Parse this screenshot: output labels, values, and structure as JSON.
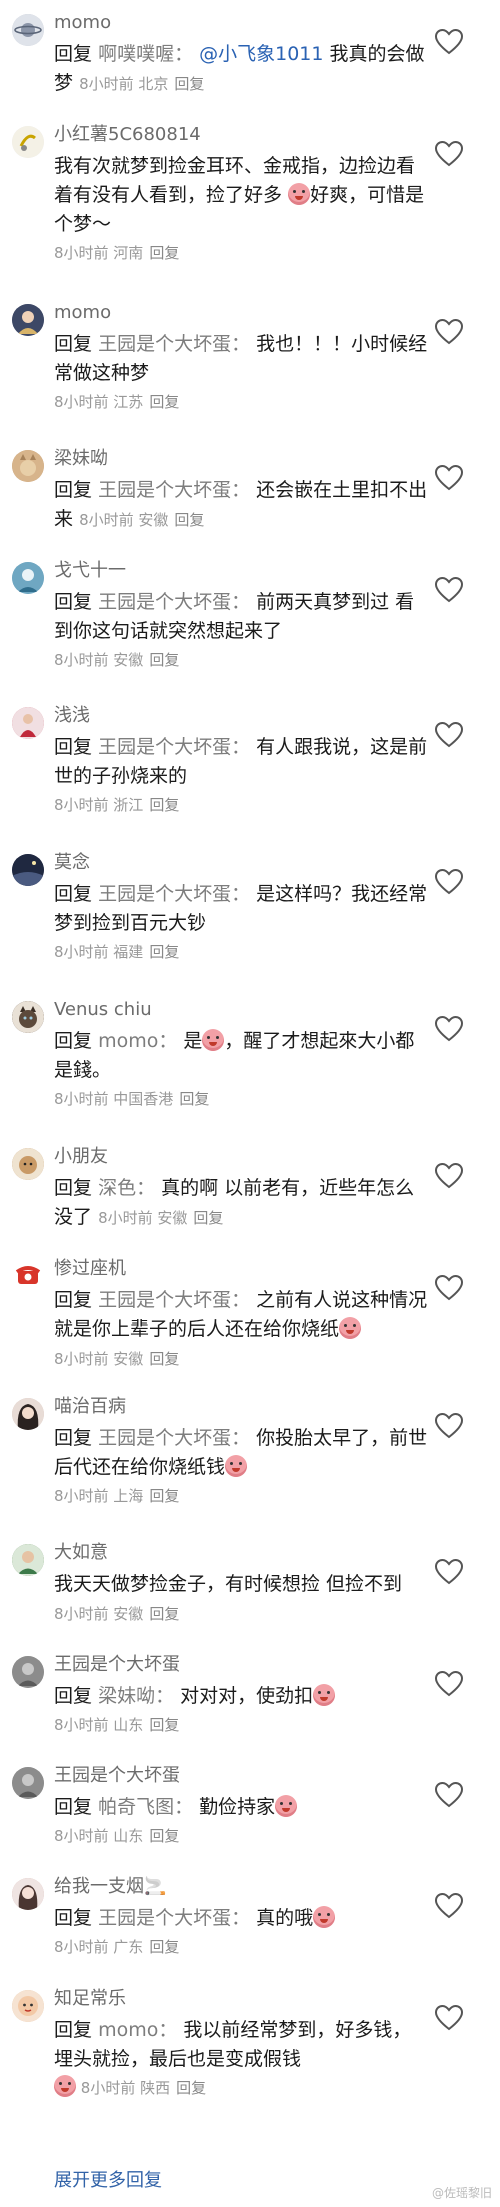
{
  "comments": [
    {
      "username": "momo",
      "avatar_color": "#c7ccd6",
      "avatar_icon": "planet-avatar-icon",
      "reply_word": "回复",
      "target": "啊噗噗喔：",
      "mention": "@小飞象1011",
      "text": "我真的会做梦",
      "meta": "8小时前 北京",
      "reply_action": "回复"
    },
    {
      "username": "小红薯5C680814",
      "avatar_color": "#eaeaea",
      "avatar_icon": "sticker-avatar-icon",
      "reply_word": "",
      "target": "",
      "mention": "",
      "text": "我有次就梦到捡金耳环、金戒指，边捡边看着有没有人看到，捡了好多",
      "text2": "好爽，可惜是个梦～",
      "meta": "8小时前 河南",
      "reply_action": "回复"
    },
    {
      "username": "momo",
      "avatar_color": "#4a5570",
      "avatar_icon": "girl-avatar-icon",
      "reply_word": "回复",
      "target": "王园是个大坏蛋：",
      "mention": "",
      "text": "我也！！！小时候经常做这种梦",
      "meta": "8小时前 江苏",
      "reply_action": "回复"
    },
    {
      "username": "梁妹呦",
      "avatar_color": "#c9a27a",
      "avatar_icon": "cat-avatar-icon",
      "reply_word": "回复",
      "target": "王园是个大坏蛋：",
      "mention": "",
      "text": "还会嵌在土里扣不出来",
      "meta": "8小时前 安徽",
      "reply_action": "回复"
    },
    {
      "username": "戈弋十一",
      "avatar_color": "#7aaec4",
      "avatar_icon": "blue-avatar-icon",
      "reply_word": "回复",
      "target": "王园是个大坏蛋：",
      "mention": "",
      "text": "前两天真梦到过 看到你这句话就突然想起来了",
      "meta": "8小时前 安徽",
      "reply_action": "回复"
    },
    {
      "username": "浅浅",
      "avatar_color": "#d88a98",
      "avatar_icon": "girl-red-avatar-icon",
      "reply_word": "回复",
      "target": "王园是个大坏蛋：",
      "mention": "",
      "text": "有人跟我说，这是前世的子孙烧来的",
      "meta": "8小时前 浙江",
      "reply_action": "回复"
    },
    {
      "username": "莫念",
      "avatar_color": "#2c3550",
      "avatar_icon": "night-avatar-icon",
      "reply_word": "回复",
      "target": "王园是个大坏蛋：",
      "mention": "",
      "text": "是这样吗？我还经常梦到捡到百元大钞",
      "meta": "8小时前 福建",
      "reply_action": "回复"
    },
    {
      "username": "Venus chiu",
      "avatar_color": "#6b5a4a",
      "avatar_icon": "cat-dark-avatar-icon",
      "reply_word": "回复",
      "target": "momo：",
      "mention": "",
      "text": "是",
      "text2": "，醒了才想起來大小都是錢。",
      "meta": "8小时前 中国香港",
      "reply_action": "回复"
    },
    {
      "username": "小朋友",
      "avatar_color": "#caa57c",
      "avatar_icon": "pet-avatar-icon",
      "reply_word": "回复",
      "target": "深色：",
      "mention": "",
      "text": "真的啊 以前老有，近些年怎么没了",
      "meta": "8小时前 安徽",
      "reply_action": "回复"
    },
    {
      "username": "惨过座机",
      "avatar_color": "#ffffff",
      "avatar_icon": "phone-avatar-icon",
      "reply_word": "回复",
      "target": "王园是个大坏蛋：",
      "mention": "",
      "text": "之前有人说这种情况就是你上辈子的后人还在给你烧纸",
      "text2": "",
      "meta": "8小时前 安徽",
      "reply_action": "回复"
    },
    {
      "username": "喵治百病",
      "avatar_color": "#d9c6c0",
      "avatar_icon": "girl-portrait-avatar-icon",
      "reply_word": "回复",
      "target": "王园是个大坏蛋：",
      "mention": "",
      "text": "你投胎太早了，前世后代还在给你烧纸钱",
      "meta": "8小时前 上海",
      "reply_action": "回复"
    },
    {
      "username": "大如意",
      "avatar_color": "#7fa37a",
      "avatar_icon": "man-avatar-icon",
      "reply_word": "",
      "target": "",
      "mention": "",
      "text": "我天天做梦捡金子，有时候想捡 但捡不到",
      "meta": "8小时前 安徽",
      "reply_action": "回复"
    },
    {
      "username": "王园是个大坏蛋",
      "avatar_color": "#9a9a9a",
      "avatar_icon": "gray-avatar-icon",
      "reply_word": "回复",
      "target": "梁妹呦：",
      "mention": "",
      "text": "对对对，使劲扣",
      "meta": "8小时前 山东",
      "reply_action": "回复"
    },
    {
      "username": "王园是个大坏蛋",
      "avatar_color": "#9a9a9a",
      "avatar_icon": "gray-avatar-icon",
      "reply_word": "回复",
      "target": "帕奇飞图：",
      "mention": "",
      "text": "勤俭持家",
      "meta": "8小时前 山东",
      "reply_action": "回复"
    },
    {
      "username": "给我一支烟🚬",
      "avatar_color": "#d6b7b3",
      "avatar_icon": "girl-smoke-avatar-icon",
      "reply_word": "回复",
      "target": "王园是个大坏蛋：",
      "mention": "",
      "text": "真的哦",
      "meta": "8小时前 广东",
      "reply_action": "回复"
    },
    {
      "username": "知足常乐",
      "avatar_color": "#e8c7a8",
      "avatar_icon": "baby-avatar-icon",
      "reply_word": "回复",
      "target": "momo：",
      "mention": "",
      "text": "我以前经常梦到，好多钱，埋头就捡，最后也是变成假钱",
      "meta": "8小时前 陕西",
      "reply_action": "回复"
    }
  ],
  "expand_more": "展开更多回复",
  "watermark": "@佐瑶黎旧"
}
